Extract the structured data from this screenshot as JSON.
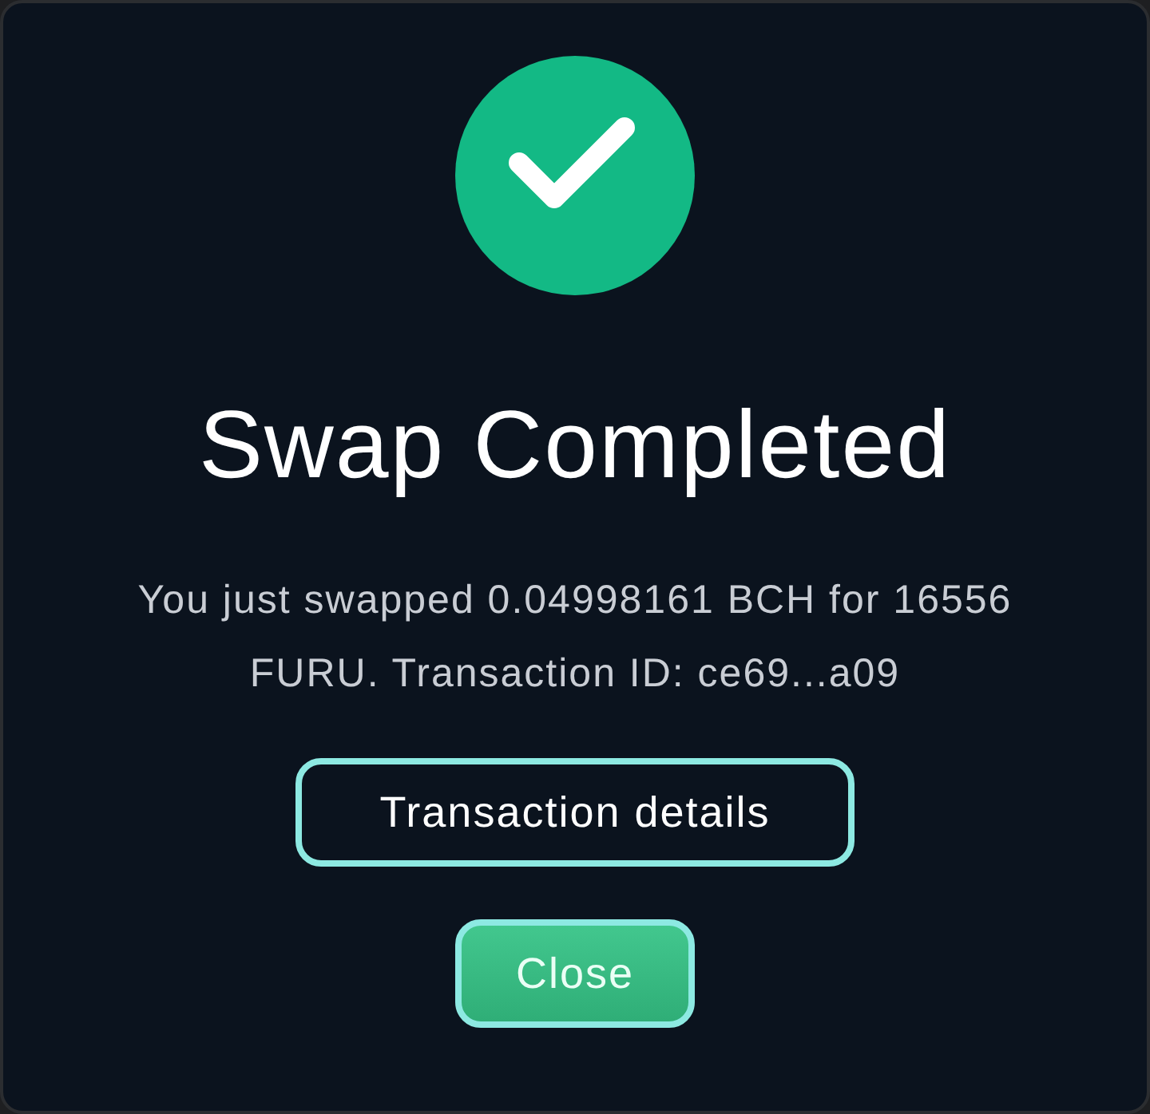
{
  "dialog": {
    "title": "Swap Completed",
    "message": "You just swapped 0.04998161 BCH for 16556 FURU. Transaction ID: ce69...a09",
    "buttons": [
      {
        "label": "Transaction details",
        "kind": "outline"
      },
      {
        "label": "Close",
        "kind": "primary"
      }
    ]
  }
}
